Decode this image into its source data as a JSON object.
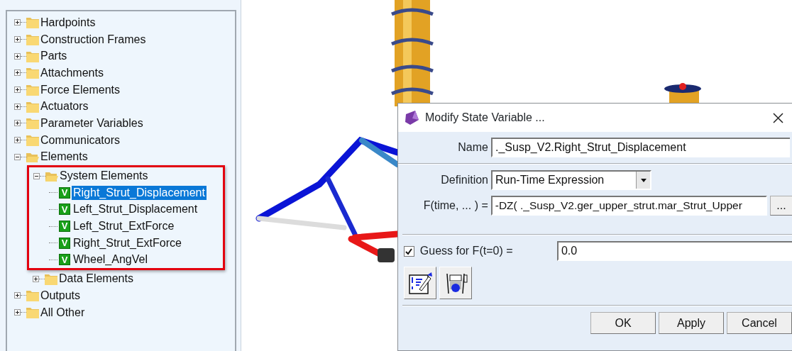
{
  "tree": [
    {
      "label": "Hardpoints",
      "kind": "folder",
      "expanded": false,
      "selected": false
    },
    {
      "label": "Construction Frames",
      "kind": "folder",
      "expanded": false,
      "selected": false
    },
    {
      "label": "Parts",
      "kind": "folder",
      "expanded": false,
      "selected": false
    },
    {
      "label": "Attachments",
      "kind": "folder",
      "expanded": false,
      "selected": false
    },
    {
      "label": "Force Elements",
      "kind": "folder",
      "expanded": false,
      "selected": false
    },
    {
      "label": "Actuators",
      "kind": "folder",
      "expanded": false,
      "selected": false
    },
    {
      "label": "Parameter Variables",
      "kind": "folder",
      "expanded": false,
      "selected": false
    },
    {
      "label": "Communicators",
      "kind": "folder",
      "expanded": false,
      "selected": false
    },
    {
      "label": "Elements",
      "kind": "folder",
      "expanded": true,
      "selected": false,
      "children": [
        {
          "label": "System Elements",
          "kind": "folder",
          "expanded": true,
          "selected": false,
          "highlighted": true,
          "children": [
            {
              "label": "Right_Strut_Displacement",
              "kind": "variable",
              "badge": "V",
              "selected": true
            },
            {
              "label": "Left_Strut_Displacement",
              "kind": "variable",
              "badge": "V",
              "selected": false
            },
            {
              "label": "Left_Strut_ExtForce",
              "kind": "variable",
              "badge": "V",
              "selected": false
            },
            {
              "label": "Right_Strut_ExtForce",
              "kind": "variable",
              "badge": "V",
              "selected": false
            },
            {
              "label": "Wheel_AngVel",
              "kind": "variable",
              "badge": "V",
              "selected": false
            }
          ]
        },
        {
          "label": "Data Elements",
          "kind": "folder",
          "expanded": false,
          "selected": false
        }
      ]
    },
    {
      "label": "Outputs",
      "kind": "folder",
      "expanded": false,
      "selected": false
    },
    {
      "label": "All Other",
      "kind": "folder",
      "expanded": false,
      "selected": false
    }
  ],
  "dialog": {
    "title": "Modify State Variable ...",
    "name": {
      "label": "Name",
      "value": "._Susp_V2.Right_Strut_Displacement"
    },
    "definition": {
      "label": "Definition",
      "value": "Run-Time Expression"
    },
    "function": {
      "label": "F(time, ... ) =",
      "value": "-DZ( ._Susp_V2.ger_upper_strut.mar_Strut_Upper",
      "button": "..."
    },
    "guess": {
      "label": "Guess for F(t=0) =",
      "checked": true,
      "value": "0.0"
    },
    "buttons": [
      "OK",
      "Apply",
      "Cancel"
    ]
  }
}
